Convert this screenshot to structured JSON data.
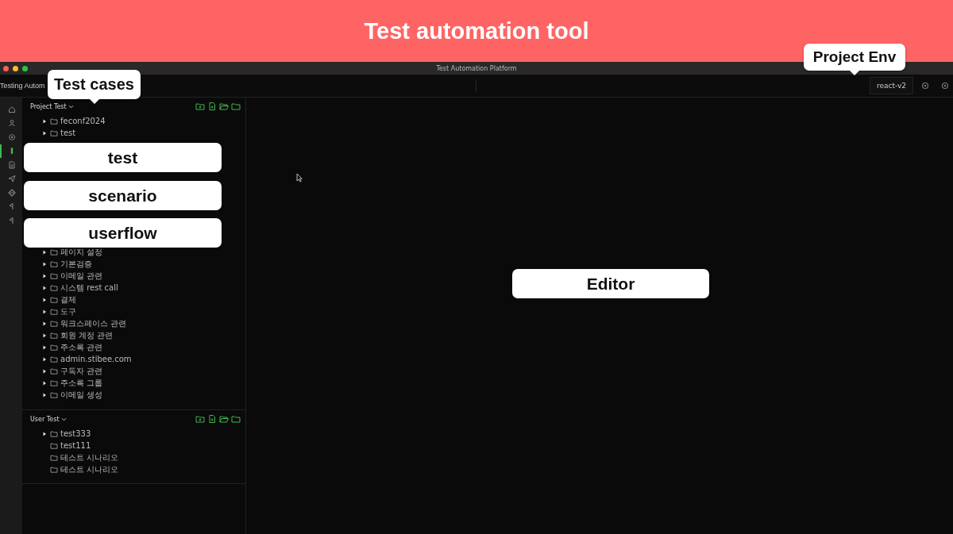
{
  "banner": {
    "title": "Test automation tool"
  },
  "window": {
    "title": "Test Automation Platform"
  },
  "toolbar": {
    "app_name": "Testing Autom",
    "env_field": "react-v2"
  },
  "sidebar": {
    "items": [
      {
        "kind": "home",
        "selected": false
      },
      {
        "kind": "user",
        "selected": false
      },
      {
        "kind": "gear",
        "selected": false
      },
      {
        "kind": "test",
        "selected": true
      },
      {
        "kind": "doc",
        "selected": false
      },
      {
        "kind": "send",
        "selected": false
      },
      {
        "kind": "diamond",
        "selected": false
      },
      {
        "kind": "flag",
        "selected": false
      },
      {
        "kind": "flag",
        "selected": false
      }
    ]
  },
  "projects": [
    {
      "name": "Project Test",
      "items_top": [
        {
          "label": "feconf2024",
          "expandable": true
        },
        {
          "label": "test",
          "expandable": true
        }
      ],
      "items_bottom": [
        {
          "label": "페이지 설정",
          "expandable": true
        },
        {
          "label": "기본검증",
          "expandable": true
        },
        {
          "label": "이메일 관련",
          "expandable": true
        },
        {
          "label": "시스템 rest call",
          "expandable": true
        },
        {
          "label": "결제",
          "expandable": true
        },
        {
          "label": "도구",
          "expandable": true
        },
        {
          "label": "워크스페이스 관련",
          "expandable": true
        },
        {
          "label": "회원 계정 관련",
          "expandable": true
        },
        {
          "label": "주소록 관련",
          "expandable": true
        },
        {
          "label": "admin.stibee.com",
          "expandable": true
        },
        {
          "label": "구독자 관련",
          "expandable": true
        },
        {
          "label": "주소록 그룹",
          "expandable": true
        },
        {
          "label": "이메일 생성",
          "expandable": true
        }
      ]
    },
    {
      "name": "User Test",
      "items_top": [
        {
          "label": "test333",
          "expandable": true
        },
        {
          "label": "test111",
          "expandable": false
        },
        {
          "label": "테스트 시나리오",
          "expandable": false
        },
        {
          "label": "테스트 시나리오",
          "expandable": false
        }
      ]
    }
  ],
  "callouts": [
    {
      "text": "Project Env",
      "pointer": true
    },
    {
      "text": "Test cases",
      "pointer": true
    },
    {
      "text": "test",
      "pointer": false
    },
    {
      "text": "scenario",
      "pointer": false
    },
    {
      "text": "userflow",
      "pointer": false
    },
    {
      "text": "Editor",
      "pointer": false
    }
  ]
}
